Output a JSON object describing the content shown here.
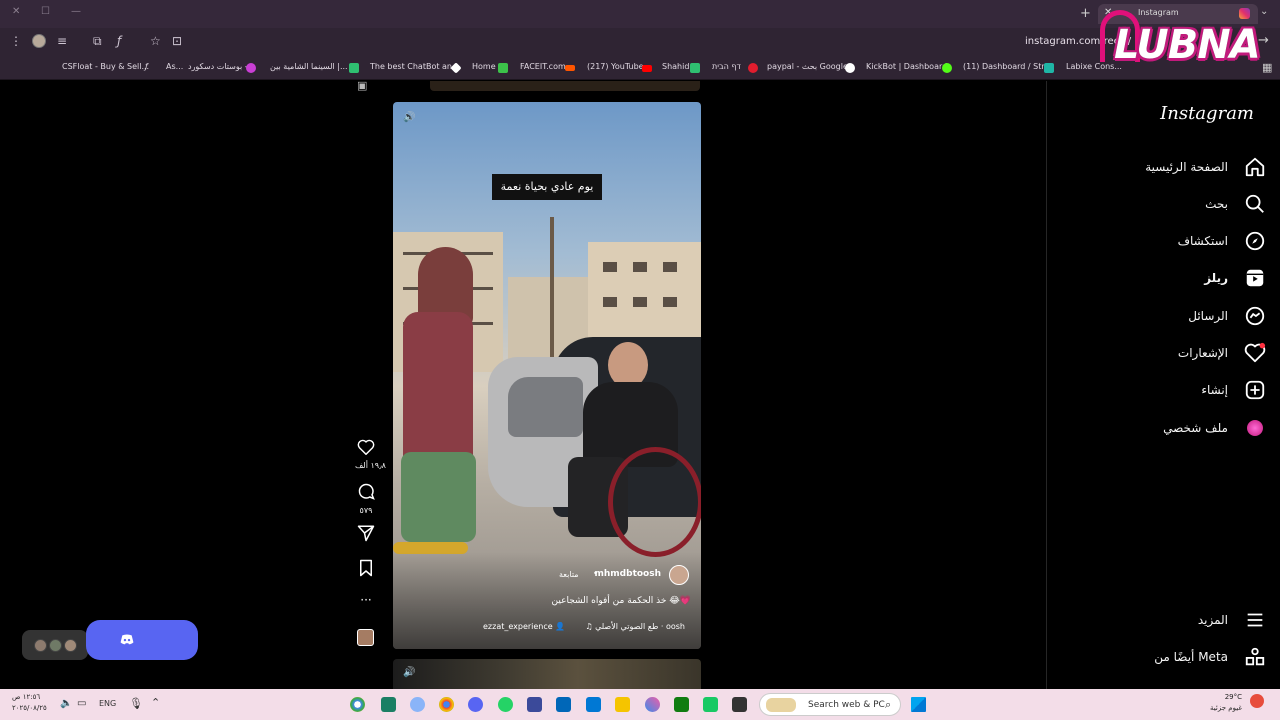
{
  "browser": {
    "tab_label": "Instagram",
    "url": "instagram.com/reels/",
    "new_tab_label": "+",
    "bookmarks": [
      {
        "label": "CSFloat - Buy & Sell..."
      },
      {
        "label": "As..."
      },
      {
        "label": "بوستات دسكورد -"
      },
      {
        "label": "السينما الشامية بين |..."
      },
      {
        "label": "The best ChatBot an..."
      },
      {
        "label": "Home"
      },
      {
        "label": "FACEIT.com"
      },
      {
        "label": "(217) YouTube"
      },
      {
        "label": "Shahid"
      },
      {
        "label": "דף הבית"
      },
      {
        "label": "paypal - بحث Google"
      },
      {
        "label": "KickBot | Dashboard"
      },
      {
        "label": "(11) Dashboard / Str..."
      },
      {
        "label": "Labixe Cons..."
      }
    ]
  },
  "overlay": {
    "brand_text": "LUBNA"
  },
  "sidebar": {
    "logo": "Instagram",
    "items": [
      {
        "label": "الصفحة الرئيسية",
        "icon": "home-icon"
      },
      {
        "label": "بحث",
        "icon": "search-icon"
      },
      {
        "label": "استكشاف",
        "icon": "explore-icon"
      },
      {
        "label": "ريلز",
        "icon": "reels-icon"
      },
      {
        "label": "الرسائل",
        "icon": "messenger-icon"
      },
      {
        "label": "الإشعارات",
        "icon": "heart-icon"
      },
      {
        "label": "إنشاء",
        "icon": "create-icon"
      },
      {
        "label": "ملف شخصي",
        "icon": "profile-avatar"
      }
    ],
    "more_label": "المزيد",
    "meta_label": "أيضًا من Meta"
  },
  "reel": {
    "overlay_caption": "يوم عادي بحياة نعمة",
    "author": "mhmdbtoosh",
    "follow_label": "متابعة",
    "caption": "خذ الحكمة من أفواه الشجاعين 😂💗",
    "audio": "طع الصوتي الأصلي · oosh",
    "collab": "ezzat_experience",
    "likes": "١٩٫٨ ألف",
    "comments": "٥٧٩"
  },
  "taskbar": {
    "time": "١٢:٥٦ ص",
    "date": "٢٠٢٥/٠٨/٢٥",
    "lang": "ENG",
    "search_placeholder": "Search web & PC",
    "temperature": "29°C",
    "weather_text": "غيوم جزئية"
  },
  "colors": {
    "accent": "#5865f2",
    "instagram_bg": "#000000",
    "brand_pink": "#e0107a"
  }
}
